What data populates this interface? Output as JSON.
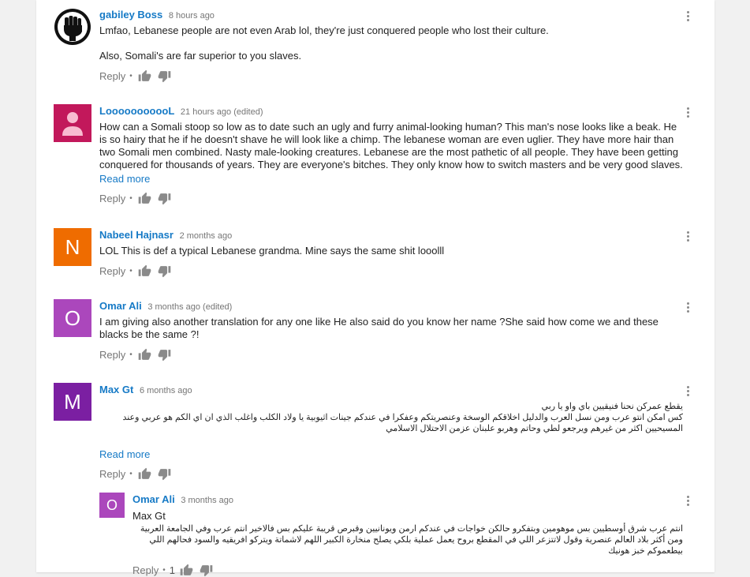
{
  "common": {
    "reply_label": "Reply",
    "read_more_label": "Read more",
    "dot": "•"
  },
  "comments": [
    {
      "author": "gabiley Boss",
      "time": "8 hours ago",
      "text1": "Lmfao, Lebanese people are not even Arab lol, they're just conquered people who lost their culture.",
      "text2": "Also, Somali's are far superior to you slaves."
    },
    {
      "author": "LooooooooooL",
      "time": "21 hours ago (edited)",
      "text": "How can a Somali stoop so low as to date such an ugly and furry animal-looking human? This man's nose looks like a beak. He is so hairy that he if he doesn't shave he will look like a chimp. The lebanese woman are even uglier. They have more hair than two Somali men combined. Nasty male-looking creatures. Lebanese are the most pathetic of all people. They have been getting conquered for thousands of years. They are everyone's bitches. They only know how to switch masters and be very good slaves."
    },
    {
      "author": "Nabeel Hajnasr",
      "time": "2 months ago",
      "avatar_letter": "N",
      "avatar_color": "#ef6c00",
      "text": "LOL This is def a typical Lebanese grandma. Mine says the same shit looolll"
    },
    {
      "author": "Omar Ali",
      "time": "3 months ago (edited)",
      "avatar_letter": "O",
      "avatar_color": "#ab47bc",
      "text": "I am giving also another translation for any one like He also said do you know her name ?She said how come we and these blacks be the same ?!"
    },
    {
      "author": "Max Gt",
      "time": "6 months ago",
      "avatar_letter": "M",
      "avatar_color": "#7b1fa2",
      "text_line1": "يقطع عمركن نحنا فنيقيين باي واو يا ربي",
      "text_line2": "كس امكن انتو عرب ومن نسل العرب والدليل اخلاقكم الوسخة وعنصريتكم وعفكرا في عندكم جينات اثيوبية يا ولاد الكلب واغلب الذي ان اي الكم هو عربي وعند المسيحيين اكثر من غيرهم ويرجعو لطي وحاتم وهربو علبنان عزمن الاحتلال الاسلامي"
    }
  ],
  "reply": {
    "author": "Omar Ali",
    "time": "3 months ago",
    "avatar_letter": "O",
    "avatar_color": "#ab47bc",
    "mention": "Max Gt",
    "text": "انتم عرب شرق أوسطيين بس موهومين وبتفكرو حالكن خواجات في عندكم ارمن ويونانيين وقبرص قريبة عليكم بس فالاخير انتم عرب وفي الجامعة العربية ومن أكثر بلاد العالم عنصرية وقول لاتتزعر اللي في المقطع بروح يعمل عملية بلكي يصلح منخارة الكبير اللهم لاشماتة ويتركو افريقيه والسود فحالهم اللي بيطعموكم خبز هونيك",
    "like_count": "1"
  }
}
